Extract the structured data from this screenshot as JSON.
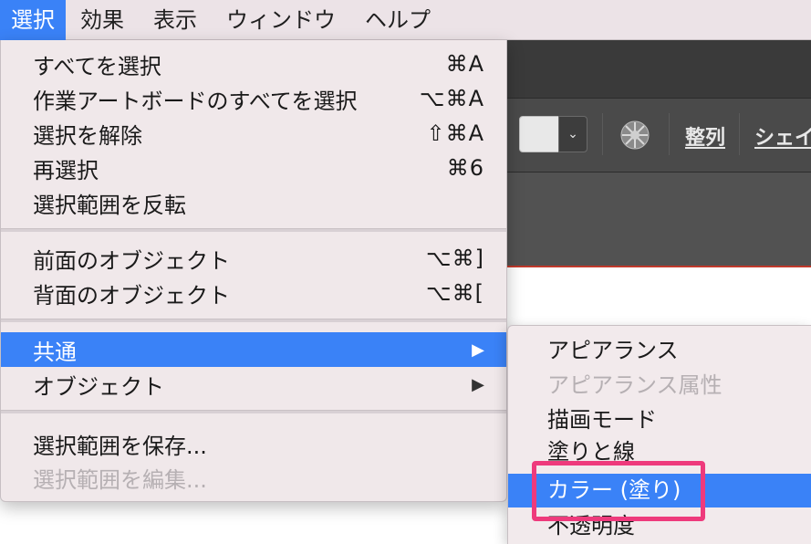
{
  "menubar": {
    "items": [
      {
        "label": "選択",
        "active": true
      },
      {
        "label": "効果",
        "active": false
      },
      {
        "label": "表示",
        "active": false
      },
      {
        "label": "ウィンドウ",
        "active": false
      },
      {
        "label": "ヘルプ",
        "active": false
      }
    ]
  },
  "main_menu": {
    "items": [
      {
        "label": "すべてを選択",
        "shortcut": "⌘A"
      },
      {
        "label": "作業アートボードのすべてを選択",
        "shortcut": "⌥⌘A"
      },
      {
        "label": "選択を解除",
        "shortcut": "⇧⌘A"
      },
      {
        "label": "再選択",
        "shortcut": "⌘6"
      },
      {
        "label": "選択範囲を反転",
        "shortcut": ""
      },
      {
        "label": "前面のオブジェクト",
        "shortcut": "⌥⌘]"
      },
      {
        "label": "背面のオブジェクト",
        "shortcut": "⌥⌘["
      },
      {
        "label": "共通",
        "submenu_arrow": "▶",
        "state": "highlighted"
      },
      {
        "label": "オブジェクト",
        "submenu_arrow": "▶"
      },
      {
        "label": "選択範囲を保存...",
        "shortcut": ""
      },
      {
        "label": "選択範囲を編集...",
        "shortcut": "",
        "state": "disabled"
      }
    ]
  },
  "submenu": {
    "items": [
      {
        "label": "アピアランス"
      },
      {
        "label": "アピアランス属性",
        "state": "disabled"
      },
      {
        "label": "描画モード"
      },
      {
        "label": "塗りと線"
      },
      {
        "label": "カラー (塗り)",
        "state": "highlighted",
        "callout": true
      },
      {
        "label": "不透明度"
      }
    ]
  },
  "toolbar": {
    "dropdown_chevron": "⌄",
    "align_label": "整列",
    "shape_label": "シェイ",
    "icons": [
      "color-wheel-icon",
      "chevron-down-icon"
    ]
  },
  "colors": {
    "accent": "#3a82f7",
    "callout": "#ee3a7c",
    "menu_bg": "#f0e8ea",
    "app_dark": "#4a4a4a",
    "disabled_text": "#b6b0b3"
  }
}
